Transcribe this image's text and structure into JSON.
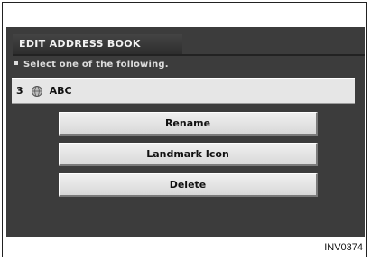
{
  "screen": {
    "title": "EDIT ADDRESS BOOK",
    "instruction": "Select one of the following.",
    "entry": {
      "number": "3",
      "icon": "globe-icon",
      "name": "ABC"
    },
    "options": [
      {
        "label": "Rename"
      },
      {
        "label": "Landmark Icon"
      },
      {
        "label": "Delete"
      }
    ]
  },
  "figure_code": "INV0374",
  "colors": {
    "screen_bg": "#3c3c3c",
    "button_face": "#e0e0e0",
    "text_light": "#dcdcdc"
  }
}
